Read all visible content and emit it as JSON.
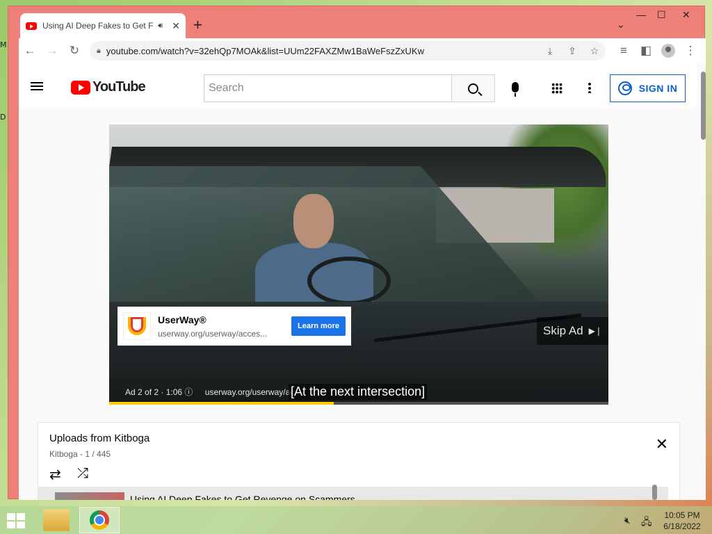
{
  "browser": {
    "tab_title": "Using AI Deep Fakes to Get F",
    "new_tab": "+",
    "url": "youtube.com/watch?v=32ehQp7MOAk&list=UUm22FAXZMw1BaWeFszZxUKw"
  },
  "desktop": {
    "frag_m": "M",
    "frag_d": "D"
  },
  "youtube": {
    "logo_text": "YouTube",
    "search_placeholder": "Search",
    "sign_in": "SIGN IN"
  },
  "ad": {
    "brand": "UserWay®",
    "url": "userway.org/userway/acces...",
    "cta": "Learn more",
    "skip": "Skip Ad",
    "info": "Ad 2 of 2 · 1:06",
    "info_url": "userway.org/userway/ac",
    "progress": 0.45
  },
  "caption": "[At the next intersection]",
  "playlist": {
    "title": "Uploads from Kitboga",
    "subtitle": "Kitboga - 1 / 445",
    "current_item": "Using AI Deep Fakes to Get Revenge on Scammers"
  },
  "taskbar": {
    "time": "10:05 PM",
    "date": "6/18/2022"
  }
}
